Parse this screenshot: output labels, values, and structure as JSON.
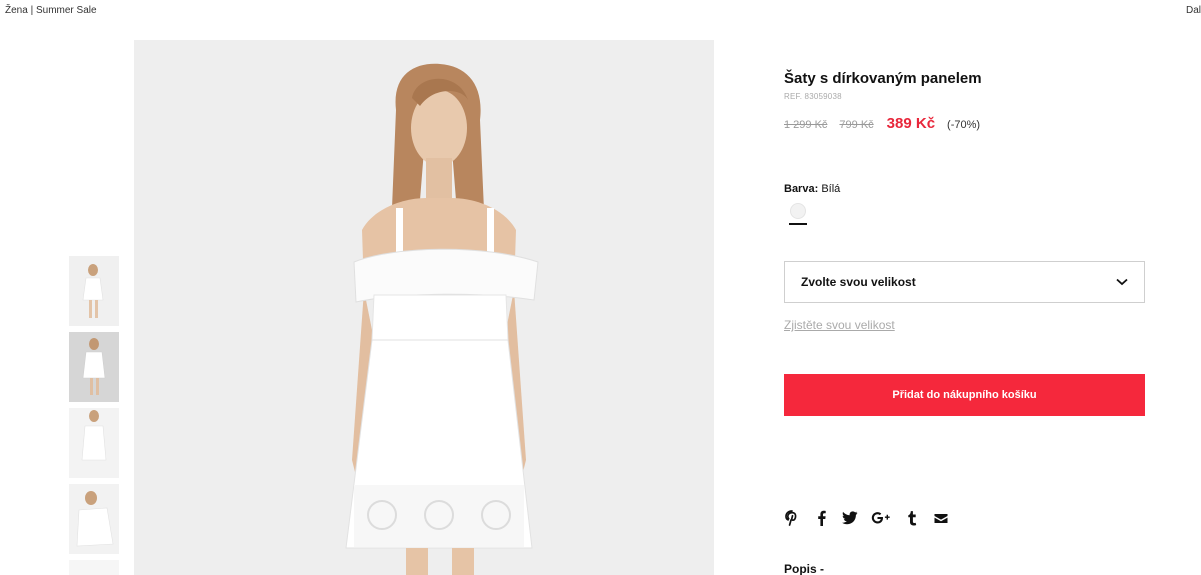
{
  "breadcrumb": {
    "part1": "Žena",
    "separator": "|",
    "part2": "Summer Sale"
  },
  "nav": {
    "next": "Dal"
  },
  "product": {
    "title": "Šaty s dírkovaným panelem",
    "ref": "REF. 83059038",
    "price_original": "1 299 Kč",
    "price_previous": "799 Kč",
    "price_sale": "389 Kč",
    "discount": "(-70%)"
  },
  "color": {
    "label": "Barva:",
    "value": "Bílá",
    "swatch_color": "#f2f2f2"
  },
  "size": {
    "placeholder": "Zvolte svou velikost",
    "guide_link": "Zjistěte svou velikost"
  },
  "cart": {
    "add_label": "Přidat do nákupního košíku"
  },
  "share": {
    "icons": [
      "pinterest-icon",
      "facebook-icon",
      "twitter-icon",
      "google-plus-icon",
      "tumblr-icon",
      "email-icon"
    ]
  },
  "description": {
    "heading": "Popis -"
  },
  "colors": {
    "accent": "#f5283c",
    "price_red": "#e8273b",
    "text": "#111111",
    "muted": "#aaaaaa"
  }
}
